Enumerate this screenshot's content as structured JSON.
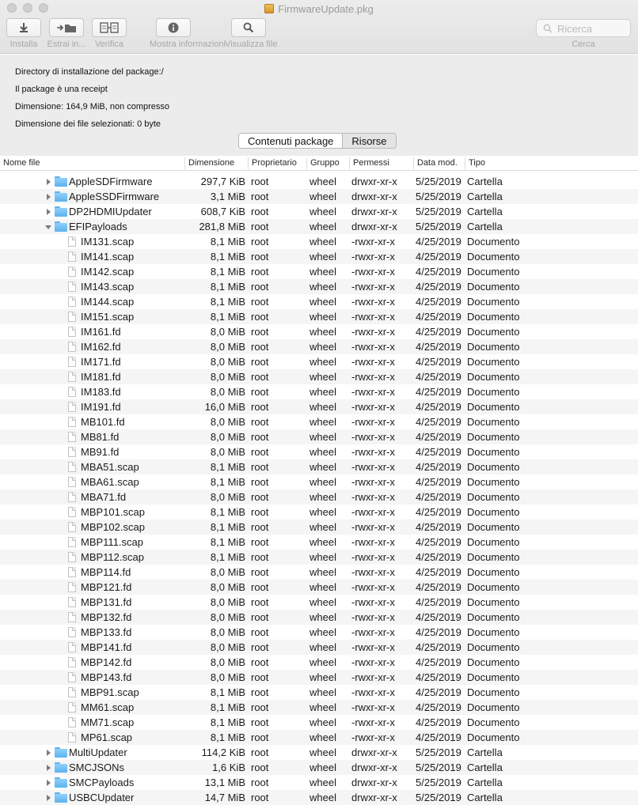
{
  "window": {
    "title": "FirmwareUpdate.pkg"
  },
  "toolbar": {
    "buttons": [
      {
        "label": "Installa",
        "icon": "download-arrow-icon"
      },
      {
        "label": "Estrai in...",
        "icon": "extract-folder-icon"
      },
      {
        "label": "Verifica",
        "icon": "verify-docs-icon"
      },
      {
        "label": "Mostra informazioni",
        "icon": "info-icon"
      },
      {
        "label": "Visualizza file",
        "icon": "magnifier-icon"
      }
    ],
    "search": {
      "placeholder": "Ricerca",
      "label": "Cerca"
    }
  },
  "info": {
    "install_dir": "Directory di installazione del package:/",
    "receipt": "Il package è una receipt",
    "size": "Dimensione: 164,9 MiB, non compresso",
    "selected_size": "Dimensione dei file selezionati: 0 byte"
  },
  "tabs": {
    "contents": "Contenuti package",
    "resources": "Risorse"
  },
  "columns": {
    "name": "Nome file",
    "size": "Dimensione",
    "owner": "Proprietario",
    "group": "Gruppo",
    "perms": "Permessi",
    "date": "Data mod.",
    "type": "Tipo"
  },
  "rows": [
    {
      "name": "AppleSDFirmware",
      "size": "297,7 KiB",
      "owner": "root",
      "group": "wheel",
      "perms": "drwxr-xr-x",
      "date": "5/25/2019",
      "type": "Cartella",
      "kind": "folder",
      "expanded": false
    },
    {
      "name": "AppleSSDFirmware",
      "size": "3,1 MiB",
      "owner": "root",
      "group": "wheel",
      "perms": "drwxr-xr-x",
      "date": "5/25/2019",
      "type": "Cartella",
      "kind": "folder",
      "expanded": false
    },
    {
      "name": "DP2HDMIUpdater",
      "size": "608,7 KiB",
      "owner": "root",
      "group": "wheel",
      "perms": "drwxr-xr-x",
      "date": "5/25/2019",
      "type": "Cartella",
      "kind": "folder",
      "expanded": false
    },
    {
      "name": "EFIPayloads",
      "size": "281,8 MiB",
      "owner": "root",
      "group": "wheel",
      "perms": "drwxr-xr-x",
      "date": "5/25/2019",
      "type": "Cartella",
      "kind": "folder",
      "expanded": true
    },
    {
      "name": "IM131.scap",
      "size": "8,1 MiB",
      "owner": "root",
      "group": "wheel",
      "perms": "-rwxr-xr-x",
      "date": "4/25/2019",
      "type": "Documento",
      "kind": "file"
    },
    {
      "name": "IM141.scap",
      "size": "8,1 MiB",
      "owner": "root",
      "group": "wheel",
      "perms": "-rwxr-xr-x",
      "date": "4/25/2019",
      "type": "Documento",
      "kind": "file"
    },
    {
      "name": "IM142.scap",
      "size": "8,1 MiB",
      "owner": "root",
      "group": "wheel",
      "perms": "-rwxr-xr-x",
      "date": "4/25/2019",
      "type": "Documento",
      "kind": "file"
    },
    {
      "name": "IM143.scap",
      "size": "8,1 MiB",
      "owner": "root",
      "group": "wheel",
      "perms": "-rwxr-xr-x",
      "date": "4/25/2019",
      "type": "Documento",
      "kind": "file"
    },
    {
      "name": "IM144.scap",
      "size": "8,1 MiB",
      "owner": "root",
      "group": "wheel",
      "perms": "-rwxr-xr-x",
      "date": "4/25/2019",
      "type": "Documento",
      "kind": "file"
    },
    {
      "name": "IM151.scap",
      "size": "8,1 MiB",
      "owner": "root",
      "group": "wheel",
      "perms": "-rwxr-xr-x",
      "date": "4/25/2019",
      "type": "Documento",
      "kind": "file"
    },
    {
      "name": "IM161.fd",
      "size": "8,0 MiB",
      "owner": "root",
      "group": "wheel",
      "perms": "-rwxr-xr-x",
      "date": "4/25/2019",
      "type": "Documento",
      "kind": "file"
    },
    {
      "name": "IM162.fd",
      "size": "8,0 MiB",
      "owner": "root",
      "group": "wheel",
      "perms": "-rwxr-xr-x",
      "date": "4/25/2019",
      "type": "Documento",
      "kind": "file"
    },
    {
      "name": "IM171.fd",
      "size": "8,0 MiB",
      "owner": "root",
      "group": "wheel",
      "perms": "-rwxr-xr-x",
      "date": "4/25/2019",
      "type": "Documento",
      "kind": "file"
    },
    {
      "name": "IM181.fd",
      "size": "8,0 MiB",
      "owner": "root",
      "group": "wheel",
      "perms": "-rwxr-xr-x",
      "date": "4/25/2019",
      "type": "Documento",
      "kind": "file"
    },
    {
      "name": "IM183.fd",
      "size": "8,0 MiB",
      "owner": "root",
      "group": "wheel",
      "perms": "-rwxr-xr-x",
      "date": "4/25/2019",
      "type": "Documento",
      "kind": "file"
    },
    {
      "name": "IM191.fd",
      "size": "16,0 MiB",
      "owner": "root",
      "group": "wheel",
      "perms": "-rwxr-xr-x",
      "date": "4/25/2019",
      "type": "Documento",
      "kind": "file"
    },
    {
      "name": "MB101.fd",
      "size": "8,0 MiB",
      "owner": "root",
      "group": "wheel",
      "perms": "-rwxr-xr-x",
      "date": "4/25/2019",
      "type": "Documento",
      "kind": "file"
    },
    {
      "name": "MB81.fd",
      "size": "8,0 MiB",
      "owner": "root",
      "group": "wheel",
      "perms": "-rwxr-xr-x",
      "date": "4/25/2019",
      "type": "Documento",
      "kind": "file"
    },
    {
      "name": "MB91.fd",
      "size": "8,0 MiB",
      "owner": "root",
      "group": "wheel",
      "perms": "-rwxr-xr-x",
      "date": "4/25/2019",
      "type": "Documento",
      "kind": "file"
    },
    {
      "name": "MBA51.scap",
      "size": "8,1 MiB",
      "owner": "root",
      "group": "wheel",
      "perms": "-rwxr-xr-x",
      "date": "4/25/2019",
      "type": "Documento",
      "kind": "file"
    },
    {
      "name": "MBA61.scap",
      "size": "8,1 MiB",
      "owner": "root",
      "group": "wheel",
      "perms": "-rwxr-xr-x",
      "date": "4/25/2019",
      "type": "Documento",
      "kind": "file"
    },
    {
      "name": "MBA71.fd",
      "size": "8,0 MiB",
      "owner": "root",
      "group": "wheel",
      "perms": "-rwxr-xr-x",
      "date": "4/25/2019",
      "type": "Documento",
      "kind": "file"
    },
    {
      "name": "MBP101.scap",
      "size": "8,1 MiB",
      "owner": "root",
      "group": "wheel",
      "perms": "-rwxr-xr-x",
      "date": "4/25/2019",
      "type": "Documento",
      "kind": "file"
    },
    {
      "name": "MBP102.scap",
      "size": "8,1 MiB",
      "owner": "root",
      "group": "wheel",
      "perms": "-rwxr-xr-x",
      "date": "4/25/2019",
      "type": "Documento",
      "kind": "file"
    },
    {
      "name": "MBP111.scap",
      "size": "8,1 MiB",
      "owner": "root",
      "group": "wheel",
      "perms": "-rwxr-xr-x",
      "date": "4/25/2019",
      "type": "Documento",
      "kind": "file"
    },
    {
      "name": "MBP112.scap",
      "size": "8,1 MiB",
      "owner": "root",
      "group": "wheel",
      "perms": "-rwxr-xr-x",
      "date": "4/25/2019",
      "type": "Documento",
      "kind": "file"
    },
    {
      "name": "MBP114.fd",
      "size": "8,0 MiB",
      "owner": "root",
      "group": "wheel",
      "perms": "-rwxr-xr-x",
      "date": "4/25/2019",
      "type": "Documento",
      "kind": "file"
    },
    {
      "name": "MBP121.fd",
      "size": "8,0 MiB",
      "owner": "root",
      "group": "wheel",
      "perms": "-rwxr-xr-x",
      "date": "4/25/2019",
      "type": "Documento",
      "kind": "file"
    },
    {
      "name": "MBP131.fd",
      "size": "8,0 MiB",
      "owner": "root",
      "group": "wheel",
      "perms": "-rwxr-xr-x",
      "date": "4/25/2019",
      "type": "Documento",
      "kind": "file"
    },
    {
      "name": "MBP132.fd",
      "size": "8,0 MiB",
      "owner": "root",
      "group": "wheel",
      "perms": "-rwxr-xr-x",
      "date": "4/25/2019",
      "type": "Documento",
      "kind": "file"
    },
    {
      "name": "MBP133.fd",
      "size": "8,0 MiB",
      "owner": "root",
      "group": "wheel",
      "perms": "-rwxr-xr-x",
      "date": "4/25/2019",
      "type": "Documento",
      "kind": "file"
    },
    {
      "name": "MBP141.fd",
      "size": "8,0 MiB",
      "owner": "root",
      "group": "wheel",
      "perms": "-rwxr-xr-x",
      "date": "4/25/2019",
      "type": "Documento",
      "kind": "file"
    },
    {
      "name": "MBP142.fd",
      "size": "8,0 MiB",
      "owner": "root",
      "group": "wheel",
      "perms": "-rwxr-xr-x",
      "date": "4/25/2019",
      "type": "Documento",
      "kind": "file"
    },
    {
      "name": "MBP143.fd",
      "size": "8,0 MiB",
      "owner": "root",
      "group": "wheel",
      "perms": "-rwxr-xr-x",
      "date": "4/25/2019",
      "type": "Documento",
      "kind": "file"
    },
    {
      "name": "MBP91.scap",
      "size": "8,1 MiB",
      "owner": "root",
      "group": "wheel",
      "perms": "-rwxr-xr-x",
      "date": "4/25/2019",
      "type": "Documento",
      "kind": "file"
    },
    {
      "name": "MM61.scap",
      "size": "8,1 MiB",
      "owner": "root",
      "group": "wheel",
      "perms": "-rwxr-xr-x",
      "date": "4/25/2019",
      "type": "Documento",
      "kind": "file"
    },
    {
      "name": "MM71.scap",
      "size": "8,1 MiB",
      "owner": "root",
      "group": "wheel",
      "perms": "-rwxr-xr-x",
      "date": "4/25/2019",
      "type": "Documento",
      "kind": "file"
    },
    {
      "name": "MP61.scap",
      "size": "8,1 MiB",
      "owner": "root",
      "group": "wheel",
      "perms": "-rwxr-xr-x",
      "date": "4/25/2019",
      "type": "Documento",
      "kind": "file"
    },
    {
      "name": "MultiUpdater",
      "size": "114,2 KiB",
      "owner": "root",
      "group": "wheel",
      "perms": "drwxr-xr-x",
      "date": "5/25/2019",
      "type": "Cartella",
      "kind": "folder",
      "expanded": false
    },
    {
      "name": "SMCJSONs",
      "size": "1,6 KiB",
      "owner": "root",
      "group": "wheel",
      "perms": "drwxr-xr-x",
      "date": "5/25/2019",
      "type": "Cartella",
      "kind": "folder",
      "expanded": false
    },
    {
      "name": "SMCPayloads",
      "size": "13,1 MiB",
      "owner": "root",
      "group": "wheel",
      "perms": "drwxr-xr-x",
      "date": "5/25/2019",
      "type": "Cartella",
      "kind": "folder",
      "expanded": false
    },
    {
      "name": "USBCUpdater",
      "size": "14,7 MiB",
      "owner": "root",
      "group": "wheel",
      "perms": "drwxr-xr-x",
      "date": "5/25/2019",
      "type": "Cartella",
      "kind": "folder",
      "expanded": false
    }
  ]
}
